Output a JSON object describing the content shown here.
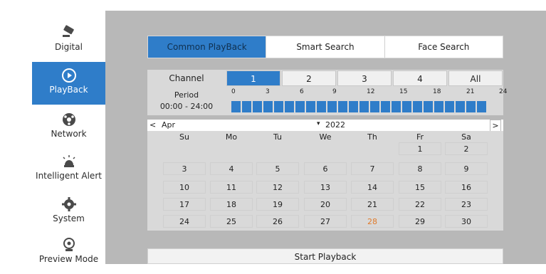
{
  "sidebar": {
    "items": [
      {
        "label": "Digital",
        "icon": "camera-icon",
        "active": false
      },
      {
        "label": "PlayBack",
        "icon": "playback-icon",
        "active": true
      },
      {
        "label": "Network",
        "icon": "network-icon",
        "active": false
      },
      {
        "label": "Intelligent Alert",
        "icon": "alert-icon",
        "active": false
      },
      {
        "label": "System",
        "icon": "gear-icon",
        "active": false
      },
      {
        "label": "Preview Mode",
        "icon": "webcam-icon",
        "active": false
      }
    ]
  },
  "tabs": [
    {
      "label": "Common PlayBack",
      "active": true
    },
    {
      "label": "Smart Search",
      "active": false
    },
    {
      "label": "Face Search",
      "active": false
    }
  ],
  "channel": {
    "label": "Channel",
    "options": [
      "1",
      "2",
      "3",
      "4",
      "All"
    ],
    "selected": "1"
  },
  "period": {
    "label": "Period",
    "range": "00:00 - 24:00",
    "ticks": [
      "0",
      "3",
      "6",
      "9",
      "12",
      "15",
      "18",
      "21",
      "24"
    ],
    "recorded_hours": 24
  },
  "calendar": {
    "prev_label": "<",
    "next_label": ">",
    "month": "Apr",
    "year": "2022",
    "dropdown_arrow": "▾",
    "weekdays": [
      "Su",
      "Mo",
      "Tu",
      "We",
      "Th",
      "Fr",
      "Sa"
    ],
    "weeks": [
      [
        "",
        "",
        "",
        "",
        "",
        "1",
        "2"
      ],
      [
        "3",
        "4",
        "5",
        "6",
        "7",
        "8",
        "9"
      ],
      [
        "10",
        "11",
        "12",
        "13",
        "14",
        "15",
        "16"
      ],
      [
        "17",
        "18",
        "19",
        "20",
        "21",
        "22",
        "23"
      ],
      [
        "24",
        "25",
        "26",
        "27",
        "28",
        "29",
        "30"
      ]
    ],
    "today": "28"
  },
  "start_button": "Start Playback",
  "colors": {
    "accent": "#2f7dc9",
    "today": "#e07b2c",
    "panel": "#d9d9d9",
    "frame": "#b8b8b8"
  }
}
